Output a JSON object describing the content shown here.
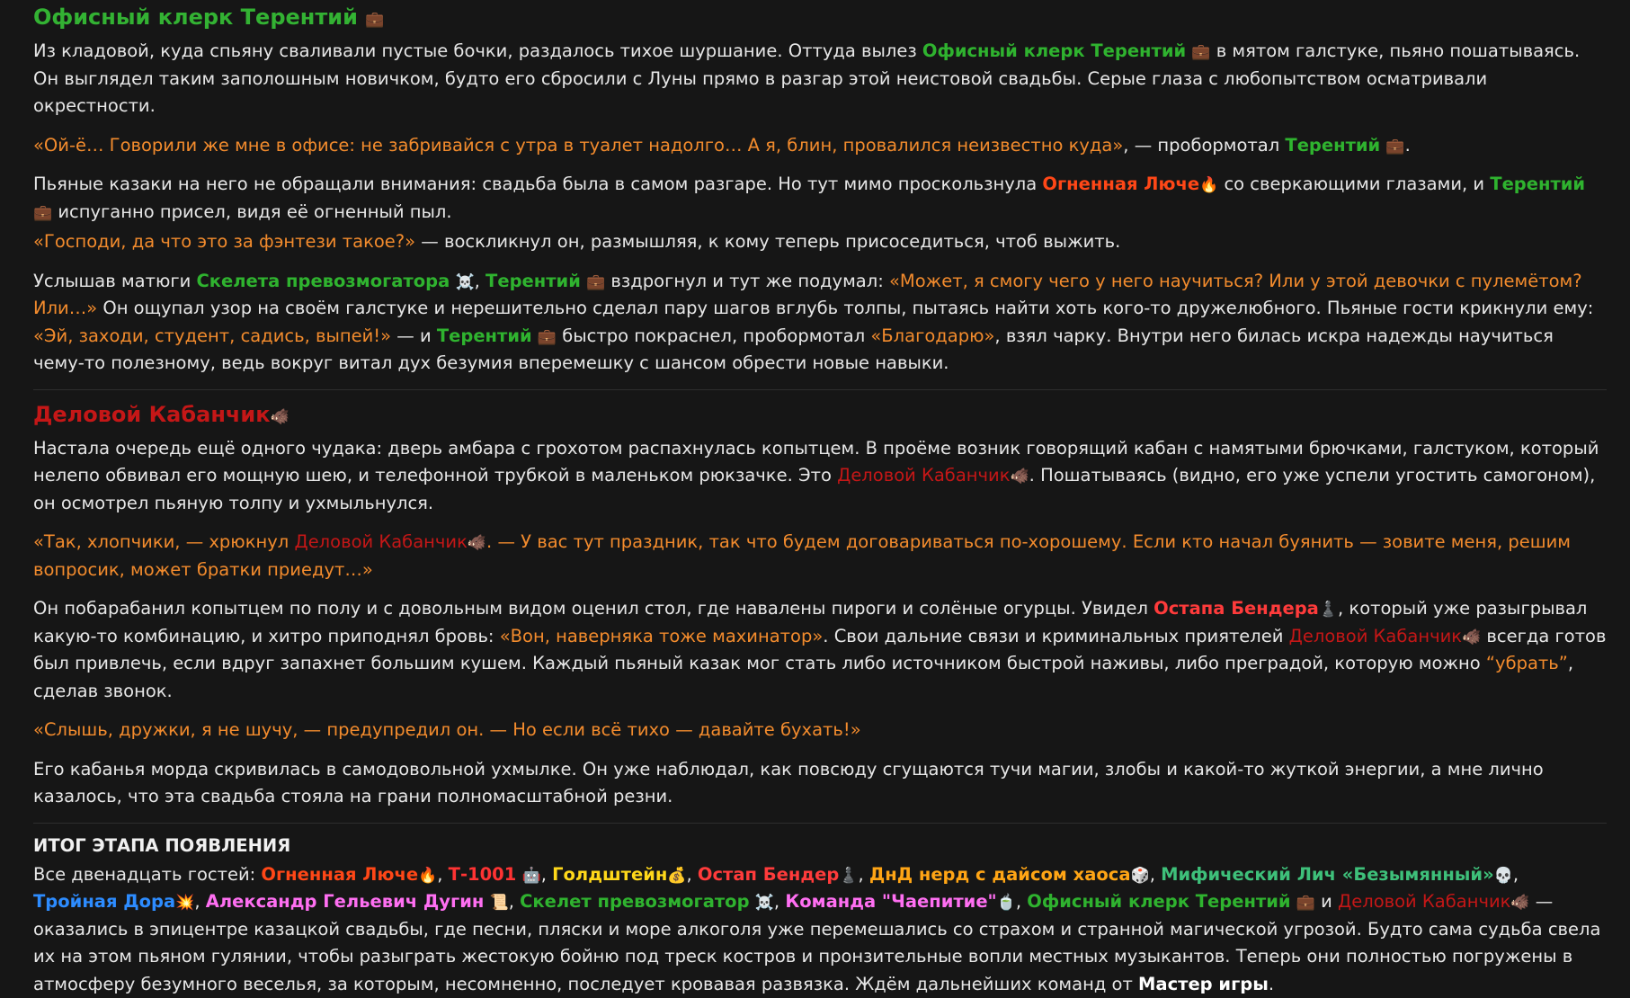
{
  "s1": {
    "title": "Офисный клерк Терентий",
    "p1_a": "Из кладовой, куда спьяну сваливали пустые бочки, раздалось тихое шуршание. Оттуда вылез ",
    "p1_name": "Офисный клерк Терентий",
    "p1_b": " в мятом галстуке, пьяно пошатываясь. Он выглядел таким заполошным новичком, будто его сбросили с Луны прямо в разгар этой неистовой свадьбы. Серые глаза с любопытством осматривали окрестности.",
    "p2_q": "«Ой-ё… Говорили же мне в офисе: не забривайся с утра в туалет надолго… А я, блин, провалился неизвестно куда»",
    "p2_b": ", — пробормотал ",
    "p2_name": "Терентий",
    "p2_c": ".",
    "p3_a": "Пьяные казаки на него не обращали внимания: свадьба была в самом разгаре. Но тут мимо проскользнула ",
    "p3_lyuche": "Огненная Люче",
    "p3_b": " со сверкающими глазами, и ",
    "p3_name": "Терентий",
    "p3_c": " испуганно присел, видя её огненный пыл.",
    "p4_q": "«Господи, да что это за фэнтези такое?»",
    "p4_b": " — воскликнул он, размышляя, к кому теперь присоседиться, чтоб выжить.",
    "p5_a": "Услышав матюги ",
    "p5_skelet": "Скелета превозмогатора",
    "p5_b": ", ",
    "p5_name": "Терентий",
    "p5_c": " вздрогнул и тут же подумал: ",
    "p5_q1": "«Может, я смогу чего у него научиться? Или у этой девочки с пулемётом? Или…»",
    "p5_d": " Он ощупал узор на своём галстуке и нерешительно сделал пару шагов вглубь толпы, пытаясь найти хоть кого-то дружелюбного. Пьяные гости крикнули ему: ",
    "p5_q2": "«Эй, заходи, студент, садись, выпей!»",
    "p5_e": " — и ",
    "p5_name2": "Терентий",
    "p5_f": " быстро покраснел, пробормотал ",
    "p5_q3": "«Благодарю»",
    "p5_g": ", взял чарку. Внутри него билась искра надежды научиться чему-то полезному, ведь вокруг витал дух безумия вперемешку с шансом обрести новые навыки."
  },
  "s2": {
    "title": "Деловой Кабанчик",
    "p1_a": "Настала очередь ещё одного чудака: дверь амбара с грохотом распахнулась копытцем. В проёме возник говорящий кабан с намятыми брючками, галстуком, который нелепо обвивал его мощную шею, и телефонной трубкой в маленьком рюкзачке. Это ",
    "p1_name": "Деловой Кабанчик",
    "p1_b": ". Пошатываясь (видно, его уже успели угостить самогоном), он осмотрел пьяную толпу и ухмыльнулся.",
    "p2_q1": "«Так, хлопчики, — хрюкнул ",
    "p2_name": "Деловой Кабанчик",
    "p2_q2": ". — У вас тут праздник, так что будем договариваться по-хорошему. Если кто начал буянить — зовите меня, решим вопросик, может братки приедут…»",
    "p3_a": "Он побарабанил копытцем по полу и с довольным видом оценил стол, где навалены пироги и солёные огурцы. Увидел ",
    "p3_ostap": "Остапа Бендера",
    "p3_b": ", который уже разыгрывал какую-то комбинацию, и хитро приподнял бровь: ",
    "p3_q1": "«Вон, наверняка тоже махинатор»",
    "p3_c": ". Свои дальние связи и криминальных приятелей ",
    "p3_name": "Деловой Кабанчик",
    "p3_d": " всегда готов был привлечь, если вдруг запахнет большим кушем. Каждый пьяный казак мог стать либо источником быстрой наживы, либо преградой, которую можно ",
    "p3_q2": "“убрать”",
    "p3_e": ", сделав звонок.",
    "p4_q": "«Слышь, дружки, я не шучу, — предупредил он. — Но если всё тихо — давайте бухать!»",
    "p5": "Его кабанья морда скривилась в самодовольной ухмылке. Он уже наблюдал, как повсюду сгущаются тучи магии, злобы и какой-то жуткой энергии, а мне лично казалось, что эта свадьба стояла на грани полномасштабной резни."
  },
  "s3": {
    "heading": "ИТОГ ЭТАПА ПОЯВЛЕНИЯ",
    "intro": "Все двенадцать гостей: ",
    "guests": [
      "Огненная Люче",
      "Т-1001",
      "Голдштейн",
      "Остап Бендер",
      "ДнД нерд с дайсом хаоса",
      "Мифический Лич «Безымянный»",
      "Тройная Дора",
      "Александр Гельевич Дугин",
      "Скелет превозмогатор",
      "Команда \"Чаепитие\"",
      "Офисный клерк Терентий",
      "Деловой Кабанчик"
    ],
    "sep": ", ",
    "and": " и ",
    "outro_a": " — оказались в эпицентре казацкой свадьбы, где песни, пляски и море алкоголя уже перемешались со страхом и странной магической угрозой. Будто сама судьба свела их на этом пьяном гулянии, чтобы разыграть жестокую бойню под треск костров и пронзительные вопли местных музыкантов. Теперь они полностью погружены в атмосферу безумного веселья, за которым, несомненно, последует кровавая развязка. Ждём дальнейших команд от ",
    "master": "Мастер игры",
    "outro_b": "."
  },
  "icons": {
    "briefcase": "💼",
    "fire": "🔥",
    "skull_crossbones": "☠️",
    "boar": "🐗",
    "pawn": "♟️",
    "robot": "🤖",
    "money_bag": "💰",
    "die": "🎲",
    "skull": "💀",
    "explosion": "💥",
    "scroll": "📜",
    "tea": "🍵"
  },
  "colors": {
    "background": "#161616",
    "text": "#e6e6e6",
    "quote": "#f28b2d",
    "clerk": "#2fb32f",
    "boar": "#c41717",
    "lyuche": "#ff4717",
    "ostap": "#ff3b3b",
    "t1001": "#ff3333",
    "goldstein": "#ffd81a",
    "dnd": "#ffa515",
    "lich": "#3ec07a",
    "dora": "#2d8cff",
    "dugin": "#ff6ff2"
  }
}
